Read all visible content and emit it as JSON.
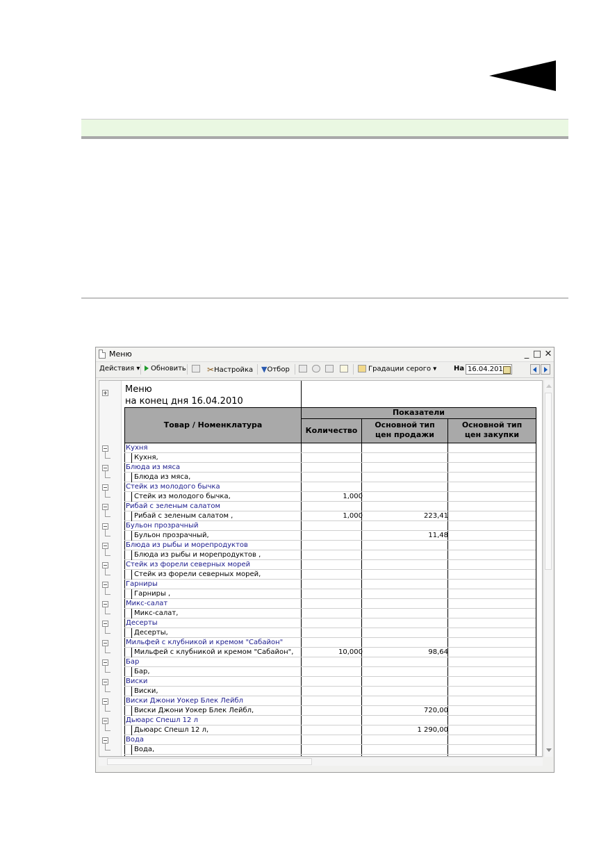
{
  "window": {
    "title": "Меню",
    "controls": {
      "minimize": "_",
      "maximize": "□",
      "close": "✕"
    }
  },
  "toolbar": {
    "actions": "Действия ▾",
    "refresh": "Обновить",
    "settings": "Настройка",
    "filter": "Отбор",
    "grayscale": "Градации серого ▾",
    "date_label": "На",
    "date_value": "16.04.2010"
  },
  "report": {
    "title_line1": "Меню",
    "title_line2": "на конец дня 16.04.2010",
    "header": {
      "product": "Товар / Номенклатура",
      "indicators": "Показатели",
      "qty": "Количество",
      "sale_line1": "Основной тип",
      "sale_line2": "цен продажи",
      "purchase_line1": "Основной тип",
      "purchase_line2": "цен закупки"
    },
    "rows": [
      {
        "type": "grp",
        "label": "Кухня",
        "qty": "",
        "sale": "",
        "purchase": ""
      },
      {
        "type": "item",
        "label": "Кухня,",
        "qty": "",
        "sale": "",
        "purchase": ""
      },
      {
        "type": "grp",
        "label": "Блюда из мяса",
        "qty": "",
        "sale": "",
        "purchase": ""
      },
      {
        "type": "item",
        "label": "Блюда из мяса,",
        "qty": "",
        "sale": "",
        "purchase": ""
      },
      {
        "type": "grp",
        "label": "Стейк из молодого бычка",
        "qty": "",
        "sale": "",
        "purchase": ""
      },
      {
        "type": "item",
        "label": "Стейк из молодого бычка,",
        "qty": "1,000",
        "sale": "",
        "purchase": ""
      },
      {
        "type": "grp",
        "label": "Рибай с зеленым салатом",
        "qty": "",
        "sale": "",
        "purchase": ""
      },
      {
        "type": "item",
        "label": "Рибай с зеленым салатом ,",
        "qty": "1,000",
        "sale": "223,41",
        "purchase": ""
      },
      {
        "type": "grp",
        "label": "Бульон прозрачный",
        "qty": "",
        "sale": "",
        "purchase": ""
      },
      {
        "type": "item",
        "label": "Бульон прозрачный,",
        "qty": "",
        "sale": "11,48",
        "purchase": ""
      },
      {
        "type": "grp",
        "label": "Блюда из рыбы и морепродуктов",
        "qty": "",
        "sale": "",
        "purchase": ""
      },
      {
        "type": "item",
        "label": "Блюда из рыбы и морепродуктов ,",
        "qty": "",
        "sale": "",
        "purchase": ""
      },
      {
        "type": "grp",
        "label": "Стейк из форели северных морей",
        "qty": "",
        "sale": "",
        "purchase": ""
      },
      {
        "type": "item",
        "label": "Стейк из форели северных морей,",
        "qty": "",
        "sale": "",
        "purchase": ""
      },
      {
        "type": "grp",
        "label": "Гарниры",
        "qty": "",
        "sale": "",
        "purchase": ""
      },
      {
        "type": "item",
        "label": "Гарниры ,",
        "qty": "",
        "sale": "",
        "purchase": ""
      },
      {
        "type": "grp",
        "label": "Микс-салат",
        "qty": "",
        "sale": "",
        "purchase": ""
      },
      {
        "type": "item",
        "label": "Микс-салат,",
        "qty": "",
        "sale": "",
        "purchase": ""
      },
      {
        "type": "grp",
        "label": "Десерты",
        "qty": "",
        "sale": "",
        "purchase": ""
      },
      {
        "type": "item",
        "label": "Десерты,",
        "qty": "",
        "sale": "",
        "purchase": ""
      },
      {
        "type": "grp",
        "label": "Мильфей с клубникой и кремом \"Сабайон\"",
        "qty": "",
        "sale": "",
        "purchase": ""
      },
      {
        "type": "item",
        "label": "Мильфей с клубникой и кремом \"Сабайон\",",
        "qty": "10,000",
        "sale": "98,64",
        "purchase": ""
      },
      {
        "type": "grp",
        "label": "Бар",
        "qty": "",
        "sale": "",
        "purchase": ""
      },
      {
        "type": "item",
        "label": "Бар,",
        "qty": "",
        "sale": "",
        "purchase": ""
      },
      {
        "type": "grp",
        "label": "Виски",
        "qty": "",
        "sale": "",
        "purchase": ""
      },
      {
        "type": "item",
        "label": "Виски,",
        "qty": "",
        "sale": "",
        "purchase": ""
      },
      {
        "type": "grp",
        "label": "Виски Джони Уокер Блек Лейбл",
        "qty": "",
        "sale": "",
        "purchase": ""
      },
      {
        "type": "item",
        "label": "Виски Джони Уокер Блек Лейбл,",
        "qty": "",
        "sale": "720,00",
        "purchase": ""
      },
      {
        "type": "grp",
        "label": "Дьюарс Спешл 12 л",
        "qty": "",
        "sale": "",
        "purchase": ""
      },
      {
        "type": "item",
        "label": "Дьюарс Спешл 12 л,",
        "qty": "",
        "sale": "1 290,00",
        "purchase": ""
      },
      {
        "type": "grp",
        "label": "Вода",
        "qty": "",
        "sale": "",
        "purchase": ""
      },
      {
        "type": "item",
        "label": "Вода,",
        "qty": "",
        "sale": "",
        "purchase": ""
      }
    ]
  }
}
